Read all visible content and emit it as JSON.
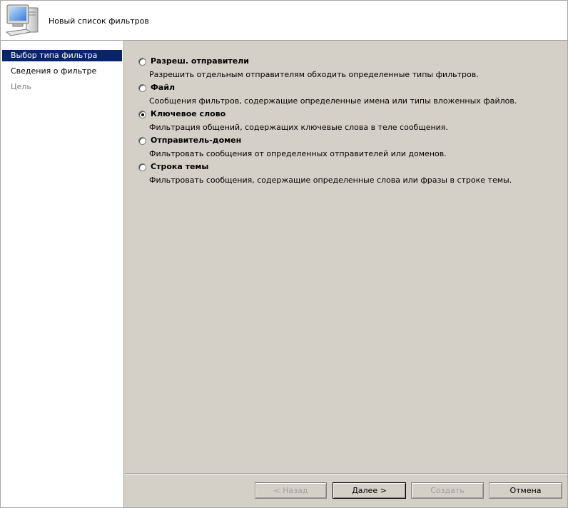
{
  "window": {
    "title": "Новый список фильтров"
  },
  "steps": [
    {
      "label": "Выбор типа фильтра",
      "state": "active"
    },
    {
      "label": "Сведения о фильтре",
      "state": "normal"
    },
    {
      "label": "Цель",
      "state": "disabled"
    }
  ],
  "options": [
    {
      "label": "Разреш. отправители",
      "description": "Разрешить отдельным отправителям обходить определенные типы фильтров.",
      "checked": false
    },
    {
      "label": "Файл",
      "description": "Сообщения фильтров, содержащие определенные имена или типы вложенных файлов.",
      "checked": false
    },
    {
      "label": "Ключевое слово",
      "description": "Фильтрация общений, содержащих ключевые слова в теле сообщения.",
      "checked": true
    },
    {
      "label": "Отправитель-домен",
      "description": "Фильтровать сообщения от определенных отправителей или доменов.",
      "checked": false
    },
    {
      "label": "Строка темы",
      "description": "Фильтровать сообщения, содержащие определенные слова или фразы в строке темы.",
      "checked": false
    }
  ],
  "buttons": {
    "back": "< Назад",
    "next": "Далее >",
    "create": "Создать",
    "cancel": "Отмена"
  },
  "icons": {
    "header": "computer-monitor-icon"
  }
}
